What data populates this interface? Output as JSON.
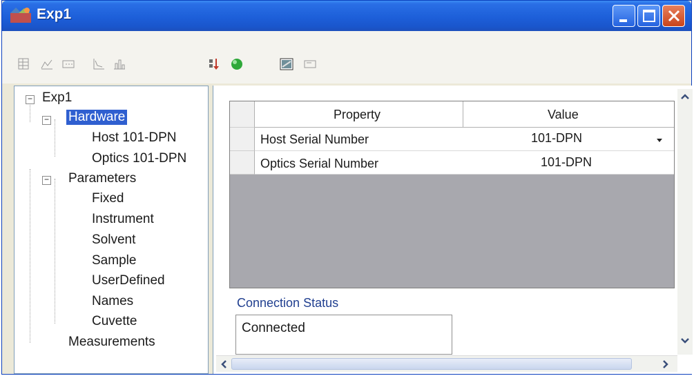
{
  "window": {
    "title": "Exp1"
  },
  "toolbar": {
    "icons": [
      "grid-view-icon",
      "line-chart-icon",
      "table-icon",
      "axis-chart-icon",
      "bar-chart-icon",
      "sort-icon",
      "status-green-icon",
      "image-window-icon",
      "panel-icon"
    ]
  },
  "tree": {
    "root": "Exp1",
    "hardware": "Hardware",
    "host": "Host 101-DPN",
    "optics": "Optics 101-DPN",
    "parameters": "Parameters",
    "fixed": "Fixed",
    "instrument": "Instrument",
    "solvent": "Solvent",
    "sample": "Sample",
    "userdefined": "UserDefined",
    "names": "Names",
    "cuvette": "Cuvette",
    "measurements": "Measurements"
  },
  "grid": {
    "col_property": "Property",
    "col_value": "Value",
    "rows": [
      {
        "property": "Host Serial Number",
        "value": "101-DPN"
      },
      {
        "property": "Optics Serial Number",
        "value": "101-DPN"
      }
    ]
  },
  "connection": {
    "label": "Connection Status",
    "value": "Connected"
  },
  "colors": {
    "titlebar": "#1d5fd9",
    "selection": "#2f5fd0",
    "grid_empty": "#a8a8ae",
    "label_blue": "#1f3e8f"
  }
}
